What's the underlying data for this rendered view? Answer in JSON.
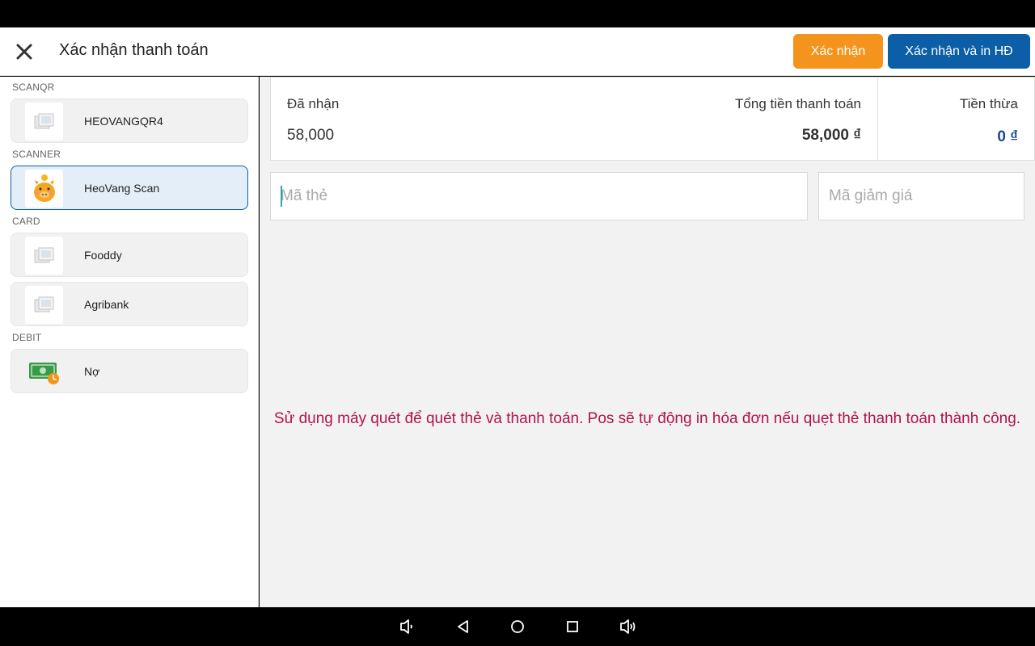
{
  "header": {
    "title": "Xác nhận thanh toán",
    "confirm_label": "Xác nhận",
    "confirm_print_label": "Xác nhận và in HĐ",
    "confirm_color": "#f5941c",
    "confirm_print_color": "#0c5ea6"
  },
  "sidebar": {
    "sections": [
      {
        "label": "SCANQR",
        "items": [
          {
            "label": "HEOVANGQR4",
            "icon": "placeholder-image-icon",
            "selected": false
          }
        ]
      },
      {
        "label": "SCANNER",
        "items": [
          {
            "label": "HeoVang Scan",
            "icon": "piggy-bank-icon",
            "selected": true
          }
        ]
      },
      {
        "label": "CARD",
        "items": [
          {
            "label": "Fooddy",
            "icon": "placeholder-image-icon",
            "selected": false
          },
          {
            "label": "Agribank",
            "icon": "placeholder-image-icon",
            "selected": false
          }
        ]
      },
      {
        "label": "DEBIT",
        "items": [
          {
            "label": "Nợ",
            "icon": "money-clock-icon",
            "selected": false
          }
        ]
      }
    ]
  },
  "summary": {
    "received_label": "Đã nhận",
    "received_value": "58,000",
    "total_label": "Tổng tiền thanh toán",
    "total_value": "58,000 ₫",
    "change_label": "Tiền thừa",
    "change_value": "0 ₫"
  },
  "inputs": {
    "card_placeholder": "Mã thẻ",
    "card_value": "",
    "discount_placeholder": "Mã giảm giá",
    "discount_value": ""
  },
  "message": "Sử dụng máy quét để quét thẻ và thanh toán. Pos sẽ tự động in hóa đơn nếu quẹt thẻ thanh toán thành công.",
  "message_color": "#b0134f",
  "nav": [
    "volume-down-icon",
    "back-icon",
    "home-icon",
    "recents-icon",
    "volume-up-icon"
  ]
}
